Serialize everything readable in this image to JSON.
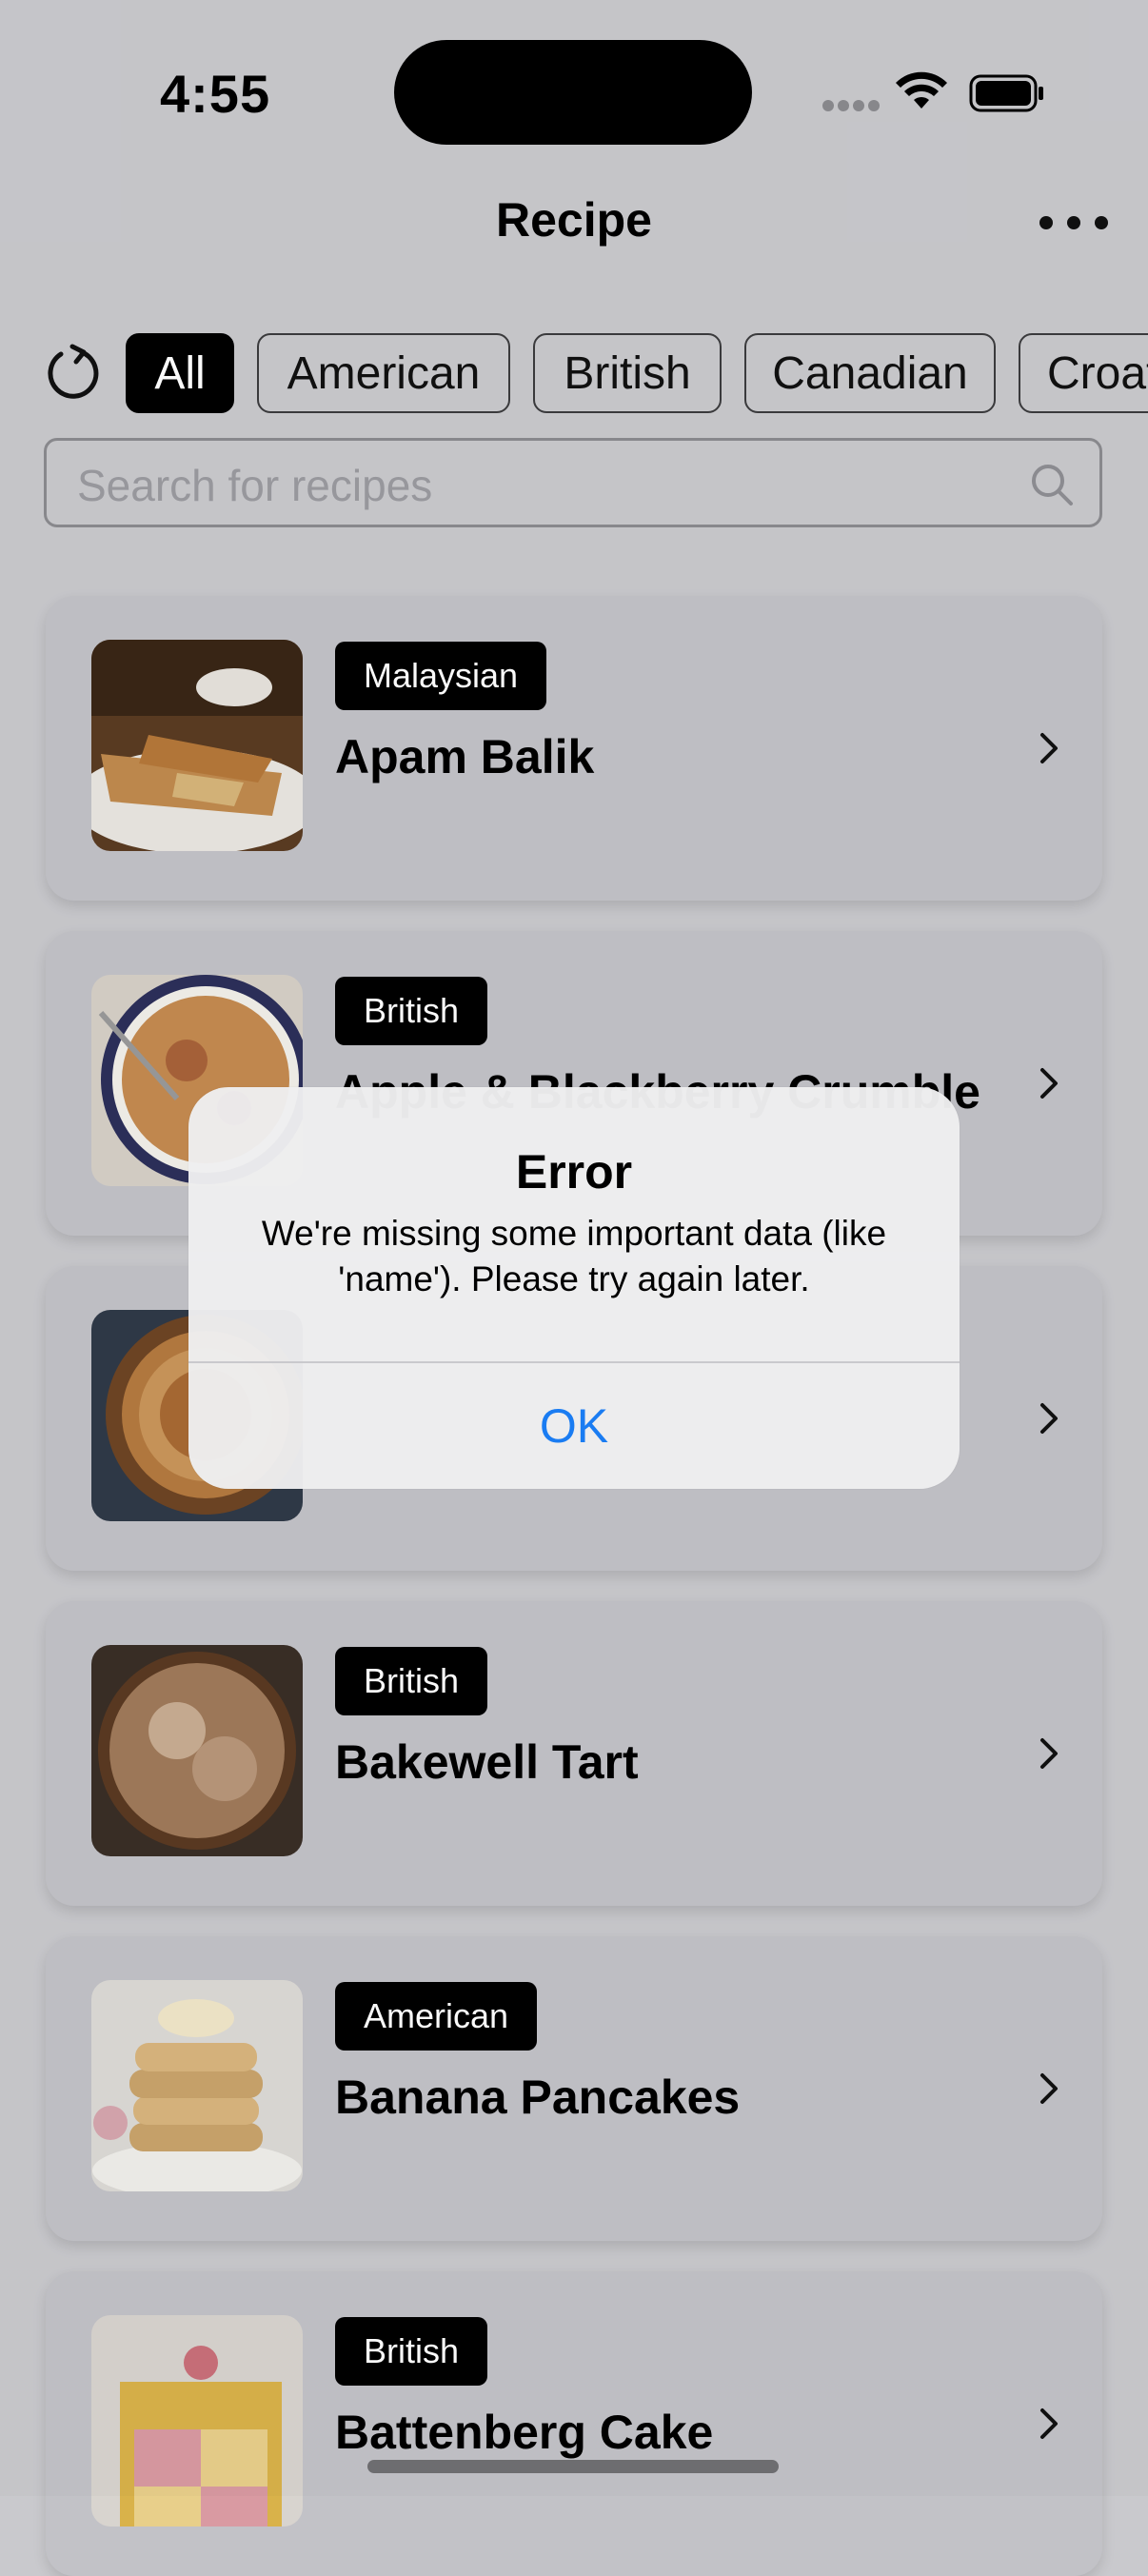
{
  "status": {
    "time": "4:55"
  },
  "nav": {
    "title": "Recipe"
  },
  "filters": [
    "All",
    "American",
    "British",
    "Canadian",
    "Croatian"
  ],
  "search": {
    "placeholder": "Search for recipes"
  },
  "recipes": [
    {
      "cuisine": "Malaysian",
      "name": "Apam Balik"
    },
    {
      "cuisine": "British",
      "name": "Apple & Blackberry Crumble"
    },
    {
      "cuisine": "",
      "name": ""
    },
    {
      "cuisine": "British",
      "name": "Bakewell Tart"
    },
    {
      "cuisine": "American",
      "name": "Banana Pancakes"
    },
    {
      "cuisine": "British",
      "name": "Battenberg Cake"
    }
  ],
  "alert": {
    "title": "Error",
    "message": "We're missing some important data (like 'name'). Please try again later.",
    "ok": "OK"
  },
  "colors": {
    "accent": "#1a7cf2",
    "tag_bg": "#000000"
  }
}
